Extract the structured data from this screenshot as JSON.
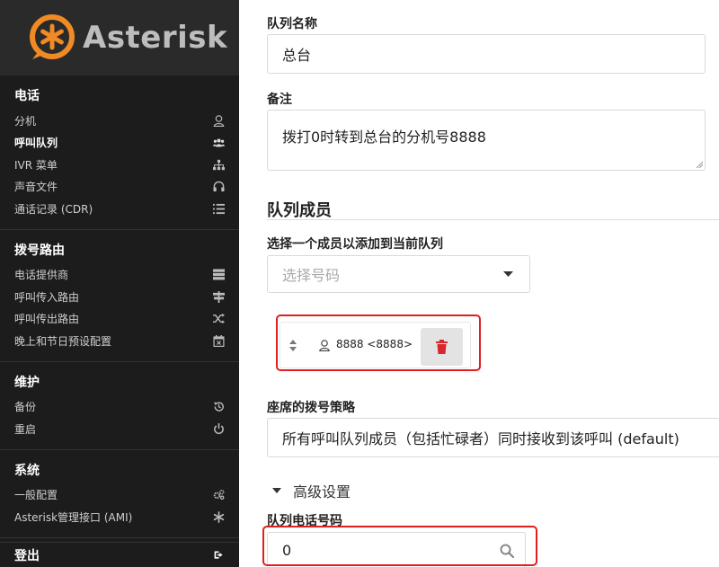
{
  "app": {
    "logo_text": "Asterisk"
  },
  "sidebar": {
    "sections": [
      {
        "title": "电话",
        "items": [
          {
            "label": "分机",
            "icon": "user-icon"
          },
          {
            "label": "呼叫队列",
            "icon": "users-icon",
            "active": true
          },
          {
            "label": "IVR 菜单",
            "icon": "sitemap-icon"
          },
          {
            "label": "声音文件",
            "icon": "headphones-icon"
          },
          {
            "label": "通话记录 (CDR)",
            "icon": "list-icon"
          }
        ]
      },
      {
        "title": "拨号路由",
        "items": [
          {
            "label": "电话提供商",
            "icon": "server-icon"
          },
          {
            "label": "呼叫传入路由",
            "icon": "signs-icon"
          },
          {
            "label": "呼叫传出路由",
            "icon": "shuffle-icon"
          },
          {
            "label": "晚上和节日预设配置",
            "icon": "calendar-x-icon"
          }
        ]
      },
      {
        "title": "维护",
        "items": [
          {
            "label": "备份",
            "icon": "history-icon"
          },
          {
            "label": "重启",
            "icon": "power-icon"
          }
        ]
      },
      {
        "title": "系统",
        "items": [
          {
            "label": "一般配置",
            "icon": "cogs-icon"
          },
          {
            "label": "Asterisk管理接口 (AMI)",
            "icon": "asterisk-icon"
          }
        ]
      }
    ],
    "logout_label": "登出"
  },
  "form": {
    "queue_name_label": "队列名称",
    "queue_name_value": "总台",
    "notes_label": "备注",
    "notes_value": "拨打0时转到总台的分机号8888",
    "members_heading": "队列成员",
    "select_member_label": "选择一个成员以添加到当前队列",
    "select_member_placeholder": "选择号码",
    "member_entry": "8888 <8888>",
    "strategy_label": "座席的拨号策略",
    "strategy_value": "所有呼叫队列成员（包括忙碌者）同时接收到该呼叫 (default)",
    "advanced_label": "高级设置",
    "queue_number_label": "队列电话号码",
    "queue_number_value": "0"
  },
  "colors": {
    "highlight": "#e02020",
    "delete_icon": "#d9262c",
    "logo_orange": "#f08a24"
  }
}
